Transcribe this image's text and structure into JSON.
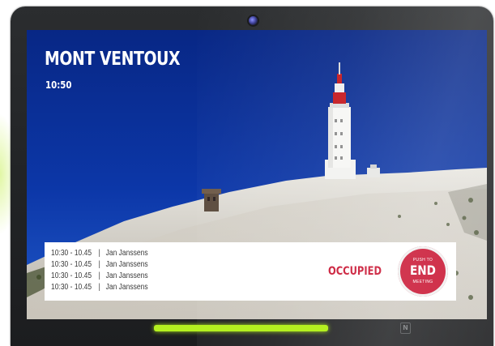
{
  "room": {
    "name": "MONT VENTOUX",
    "time": "10:50"
  },
  "schedule": [
    {
      "time": "10:30 - 10.45",
      "separator": "|",
      "person": "Jan Janssens"
    },
    {
      "time": "10:30 - 10.45",
      "separator": "|",
      "person": "Jan Janssens"
    },
    {
      "time": "10:30 - 10.45",
      "separator": "|",
      "person": "Jan Janssens"
    },
    {
      "time": "10:30 - 10.45",
      "separator": "|",
      "person": "Jan Janssens"
    }
  ],
  "status": {
    "label": "OCCUPIED",
    "color": "#c8102e"
  },
  "end_button": {
    "top_text": "PUSH TO",
    "main_text": "END",
    "bottom_text": "MEETING"
  },
  "device": {
    "led_color": "#b4f020",
    "nfc_icon": "nfc-icon",
    "nfc_symbol": "N"
  }
}
